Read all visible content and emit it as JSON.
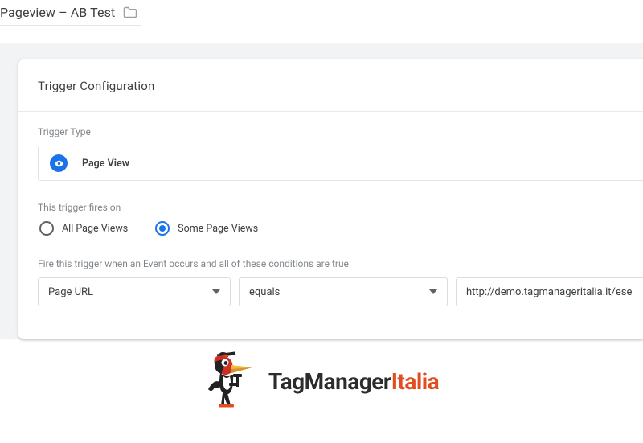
{
  "title": "Pageview – AB Test",
  "card": {
    "heading": "Trigger Configuration",
    "typeLabel": "Trigger Type",
    "typeName": "Page View",
    "firesOnLabel": "This trigger fires on",
    "radioAll": "All Page Views",
    "radioSome": "Some Page Views",
    "conditionsLabel": "Fire this trigger when an Event occurs and all of these conditions are true",
    "variable": "Page URL",
    "operator": "equals",
    "value": "http://demo.tagmanageritalia.it/esem"
  },
  "brand": {
    "part1": "TagManager",
    "part2": "Italia"
  }
}
